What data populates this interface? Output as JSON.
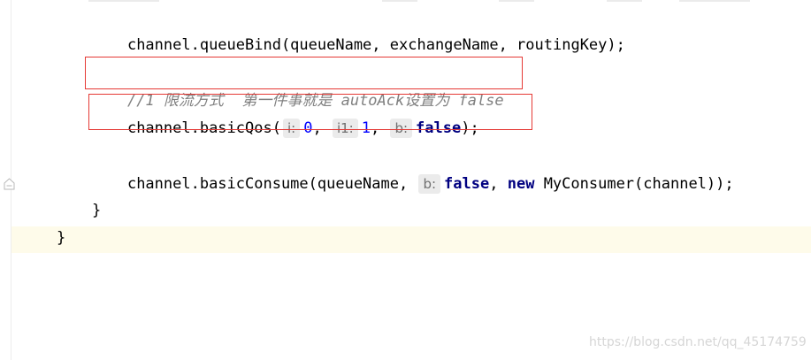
{
  "code": {
    "line_queue_bind": "channel.queueBind(queueName, exchangeName, routingKey);",
    "comment_line": "//1 限流方式  第一件事就是 autoAck设置为 false",
    "basic_qos": {
      "prefix": "channel.basicQos(",
      "hint_i": "i:",
      "arg_i": "0",
      "sep1": ",",
      "hint_i1": "i1:",
      "arg_i1": "1",
      "sep2": ",",
      "hint_b": "b:",
      "arg_b": "false",
      "suffix": ");"
    },
    "basic_consume": {
      "prefix": "channel.basicConsume(queueName, ",
      "hint_b": "b:",
      "arg_b": "false",
      "sep": ",",
      "new_kw": "new",
      "suffix": " MyConsumer(channel));"
    },
    "close_method": "}",
    "close_class": "}"
  },
  "watermark": "https://blog.csdn.net/qq_45174759",
  "colors": {
    "highlight_box": "#e53935",
    "keyword": "#000080",
    "number": "#0000ff",
    "comment": "#808080",
    "current_line": "#fefbea"
  }
}
